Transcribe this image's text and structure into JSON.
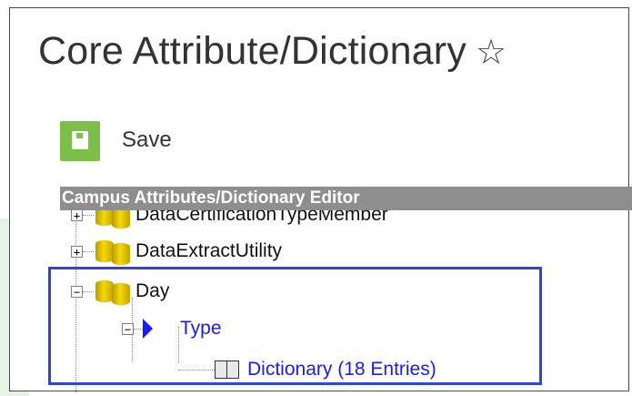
{
  "page": {
    "title": "Core Attribute/Dictionary",
    "favorite_icon": "star-outline-icon"
  },
  "toolbar": {
    "save_label": "Save",
    "save_icon": "floppy-disk-icon",
    "save_color": "#7cc04a"
  },
  "editor": {
    "header": "Campus Attributes/Dictionary Editor"
  },
  "tree": {
    "items": [
      {
        "label": "DataCertificationTypeMember",
        "icon": "database-icon",
        "toggle": "+"
      },
      {
        "label": "DataExtractUtility",
        "icon": "database-icon",
        "toggle": "+"
      },
      {
        "label": "Day",
        "icon": "database-icon",
        "toggle": "−"
      },
      {
        "label": "Type",
        "icon": "play-arrow-icon",
        "toggle": "−"
      },
      {
        "label": "Dictionary (18 Entries)",
        "icon": "book-icon"
      }
    ]
  },
  "highlight_color": "#3344dd"
}
